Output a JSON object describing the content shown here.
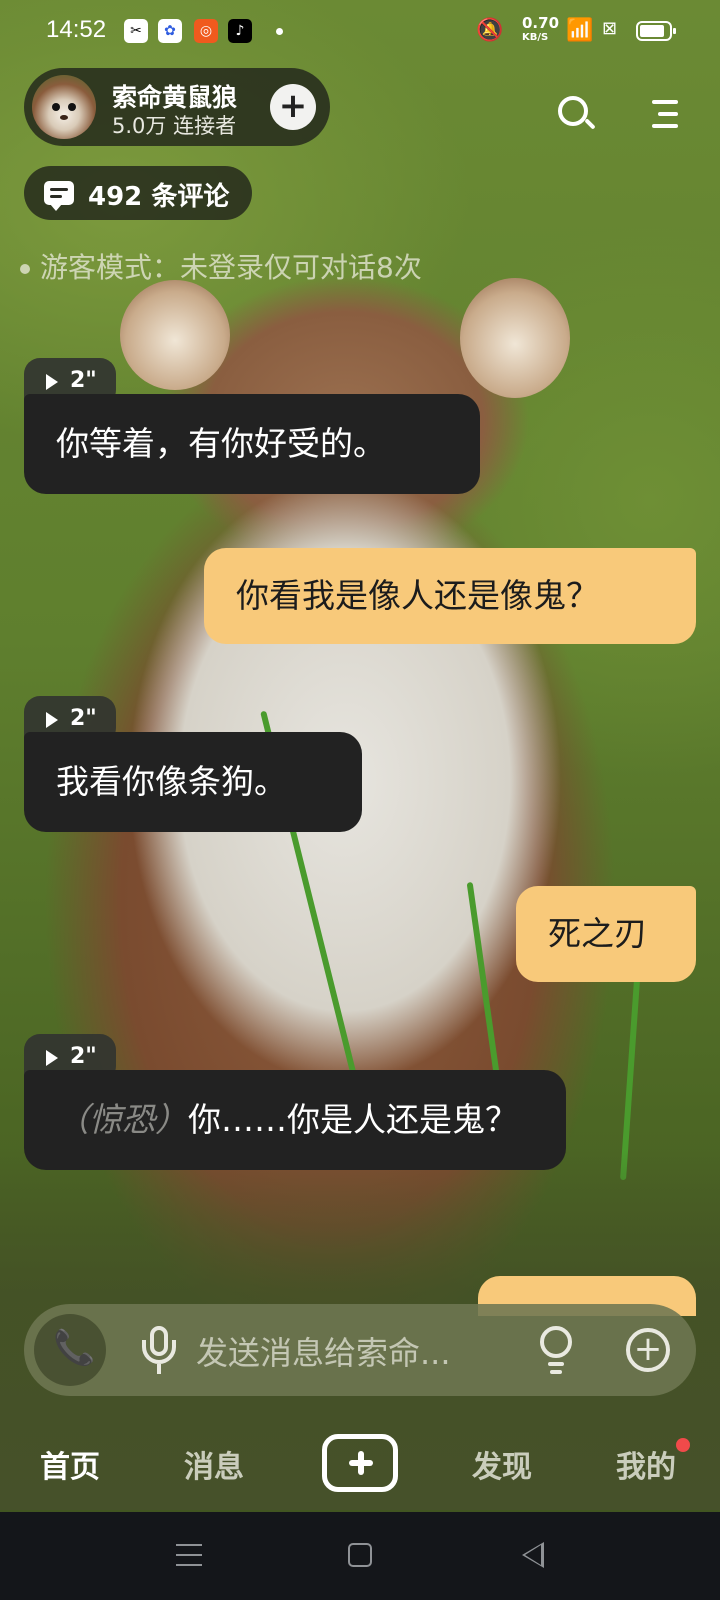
{
  "status_bar": {
    "time": "14:52",
    "apps": [
      "capcut-icon",
      "baidu-icon",
      "xiaohongshu-icon",
      "tiktok-icon"
    ],
    "net_speed_value": "0.70",
    "net_speed_unit": "KB/S",
    "battery_level": 0.85
  },
  "header": {
    "character_name": "索命黄鼠狼",
    "connectors": "5.0万 连接者",
    "follow_symbol": "+",
    "comments_label": "492 条评论",
    "guest_mode": "游客模式：未登录仅可对话8次"
  },
  "messages": [
    {
      "role": "bot",
      "duration": "2\"",
      "text": "你等着，有你好受的。"
    },
    {
      "role": "user",
      "text": "你看我是像人还是像鬼？"
    },
    {
      "role": "bot",
      "duration": "2\"",
      "text": "我看你像条狗。"
    },
    {
      "role": "user",
      "text": "死之刃"
    },
    {
      "role": "bot",
      "duration": "2\"",
      "action": "（惊恐）",
      "text": "你……你是人还是鬼？"
    }
  ],
  "input": {
    "placeholder": "发送消息给索命..."
  },
  "bottom_nav": {
    "home": "首页",
    "messages": "消息",
    "discover": "发现",
    "mine": "我的"
  },
  "colors": {
    "user_bubble": "#f8c97a",
    "bot_bubble": "#222222",
    "badge": "#f04a4a"
  }
}
